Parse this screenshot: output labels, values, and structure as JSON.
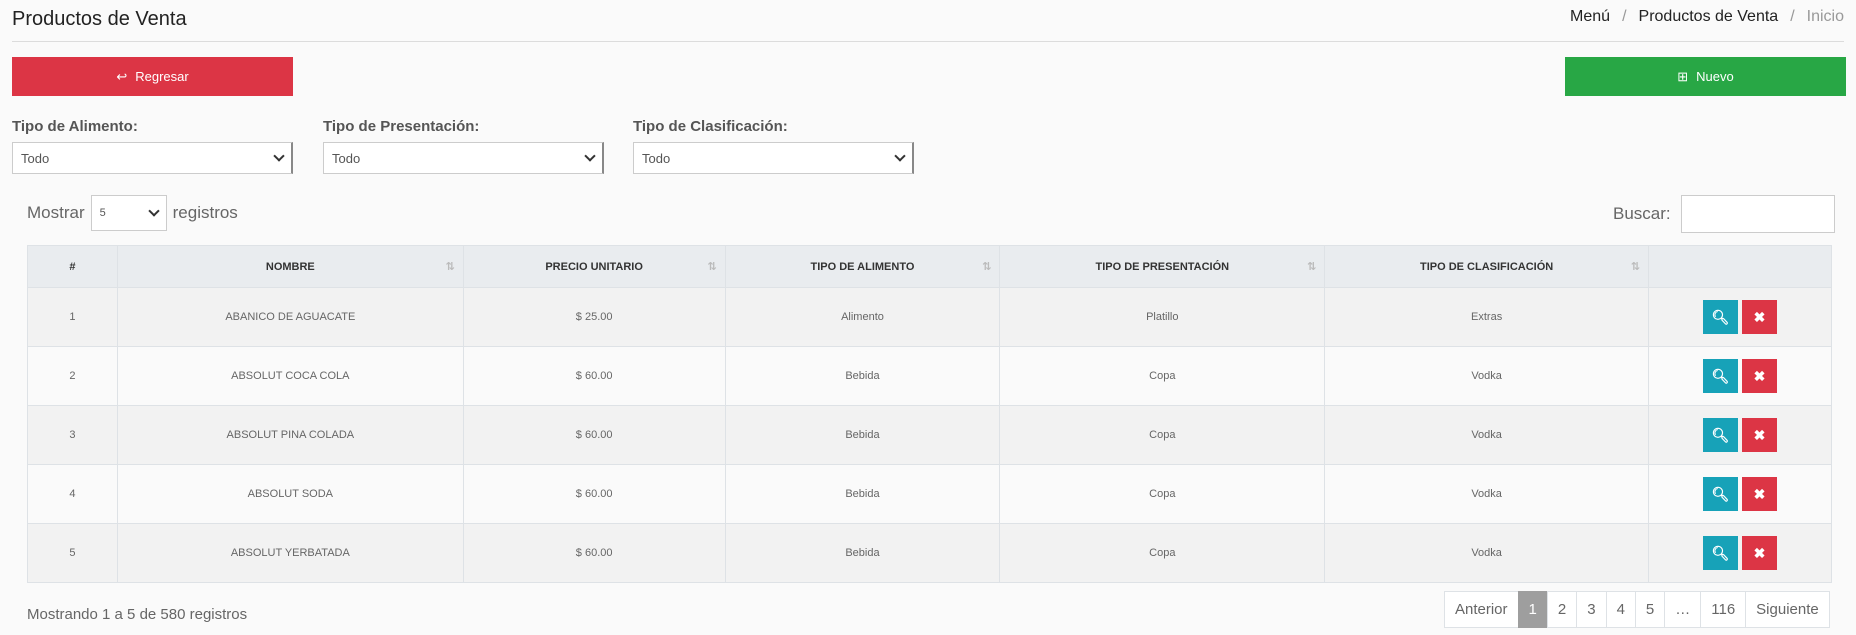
{
  "header": {
    "title": "Productos de Venta",
    "breadcrumb": [
      "Menú",
      "Productos de Venta",
      "Inicio"
    ]
  },
  "buttons": {
    "back": "Regresar",
    "new": "Nuevo"
  },
  "filters": [
    {
      "label": "Tipo de Alimento:",
      "value": "Todo"
    },
    {
      "label": "Tipo de Presentación:",
      "value": "Todo"
    },
    {
      "label": "Tipo de Clasificación:",
      "value": "Todo"
    }
  ],
  "length": {
    "prefix": "Mostrar",
    "value": "5",
    "suffix": "registros"
  },
  "search": {
    "label": "Buscar:",
    "value": ""
  },
  "table": {
    "columns": [
      "#",
      "NOMBRE",
      "PRECIO UNITARIO",
      "TIPO DE ALIMENTO",
      "TIPO DE PRESENTACIÓN",
      "TIPO DE CLASIFICACIÓN",
      ""
    ],
    "rows": [
      [
        "1",
        "ABANICO DE AGUACATE",
        "$ 25.00",
        "Alimento",
        "Platillo",
        "Extras"
      ],
      [
        "2",
        "ABSOLUT COCA COLA",
        "$ 60.00",
        "Bebida",
        "Copa",
        "Vodka"
      ],
      [
        "3",
        "ABSOLUT PINA COLADA",
        "$ 60.00",
        "Bebida",
        "Copa",
        "Vodka"
      ],
      [
        "4",
        "ABSOLUT SODA",
        "$ 60.00",
        "Bebida",
        "Copa",
        "Vodka"
      ],
      [
        "5",
        "ABSOLUT YERBATADA",
        "$ 60.00",
        "Bebida",
        "Copa",
        "Vodka"
      ]
    ]
  },
  "footer": {
    "info": "Mostrando 1 a 5 de 580 registros",
    "pages": [
      "Anterior",
      "1",
      "2",
      "3",
      "4",
      "5",
      "…",
      "116",
      "Siguiente"
    ],
    "active_page": "1"
  },
  "colors": {
    "back_button": "#dc3545",
    "new_button": "#28a745",
    "view_button": "#17a2b8",
    "delete_button": "#dc3545"
  }
}
